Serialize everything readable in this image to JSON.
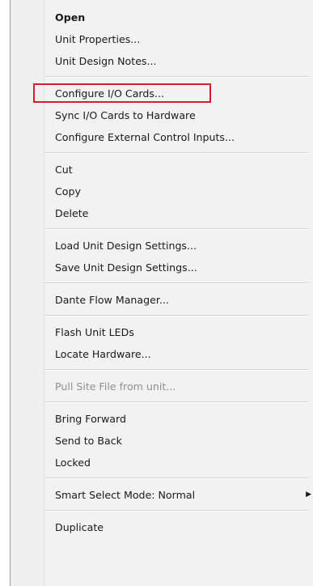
{
  "menu": {
    "group1": {
      "open": "Open",
      "unit_properties": "Unit Properties...",
      "unit_design_notes": "Unit Design Notes..."
    },
    "group2": {
      "configure_io_cards": "Configure I/O Cards...",
      "sync_io_cards": "Sync I/O Cards to Hardware",
      "configure_external_control_inputs": "Configure External Control Inputs..."
    },
    "group3": {
      "cut": "Cut",
      "copy": "Copy",
      "delete": "Delete"
    },
    "group4": {
      "load_unit_design_settings": "Load Unit Design Settings...",
      "save_unit_design_settings": "Save Unit Design Settings..."
    },
    "group5": {
      "dante_flow_manager": "Dante Flow Manager..."
    },
    "group6": {
      "flash_unit_leds": "Flash Unit LEDs",
      "locate_hardware": "Locate Hardware..."
    },
    "group7": {
      "pull_site_file": "Pull Site File from unit..."
    },
    "group8": {
      "bring_forward": "Bring Forward",
      "send_to_back": "Send to Back",
      "locked": "Locked"
    },
    "group9": {
      "smart_select_mode": "Smart Select Mode: Normal"
    },
    "group10": {
      "duplicate": "Duplicate"
    }
  },
  "icons": {
    "submenu_arrow": "submenu-arrow-icon",
    "submenu_arrow_glyph": "▶"
  },
  "colors": {
    "highlight_border": "#e0192a",
    "menu_background": "#f2f2f2",
    "disabled_text": "#8f8f8f"
  }
}
